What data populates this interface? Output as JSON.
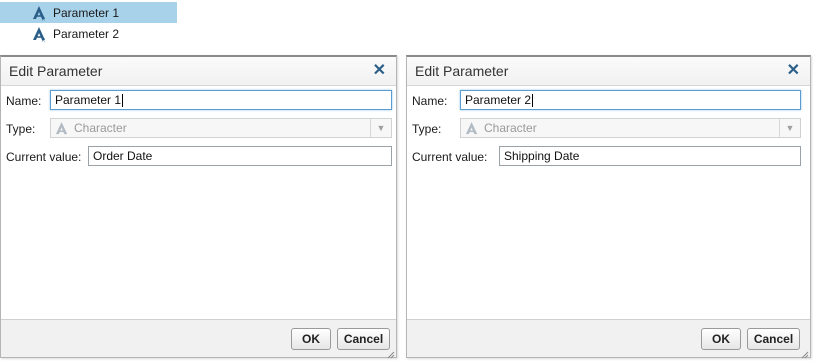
{
  "parameter_list": {
    "items": [
      {
        "label": "Parameter 1",
        "icon": "character-parameter-icon",
        "selected": true
      },
      {
        "label": "Parameter 2",
        "icon": "character-parameter-icon",
        "selected": false
      }
    ]
  },
  "dialogs": [
    {
      "title": "Edit Parameter",
      "close_symbol": "✕",
      "name_label": "Name:",
      "name_value": "Parameter 1",
      "type_label": "Type:",
      "type_value": "Character",
      "current_value_label": "Current value:",
      "current_value": "Order Date",
      "ok_label": "OK",
      "cancel_label": "Cancel"
    },
    {
      "title": "Edit Parameter",
      "close_symbol": "✕",
      "name_label": "Name:",
      "name_value": "Parameter 2",
      "type_label": "Type:",
      "type_value": "Character",
      "current_value_label": "Current value:",
      "current_value": "Shipping Date",
      "ok_label": "OK",
      "cancel_label": "Cancel"
    }
  ],
  "colors": {
    "selection": "#a7d2ea",
    "icon_blue": "#2b5f8a",
    "focus_border": "#5a9bd0"
  }
}
